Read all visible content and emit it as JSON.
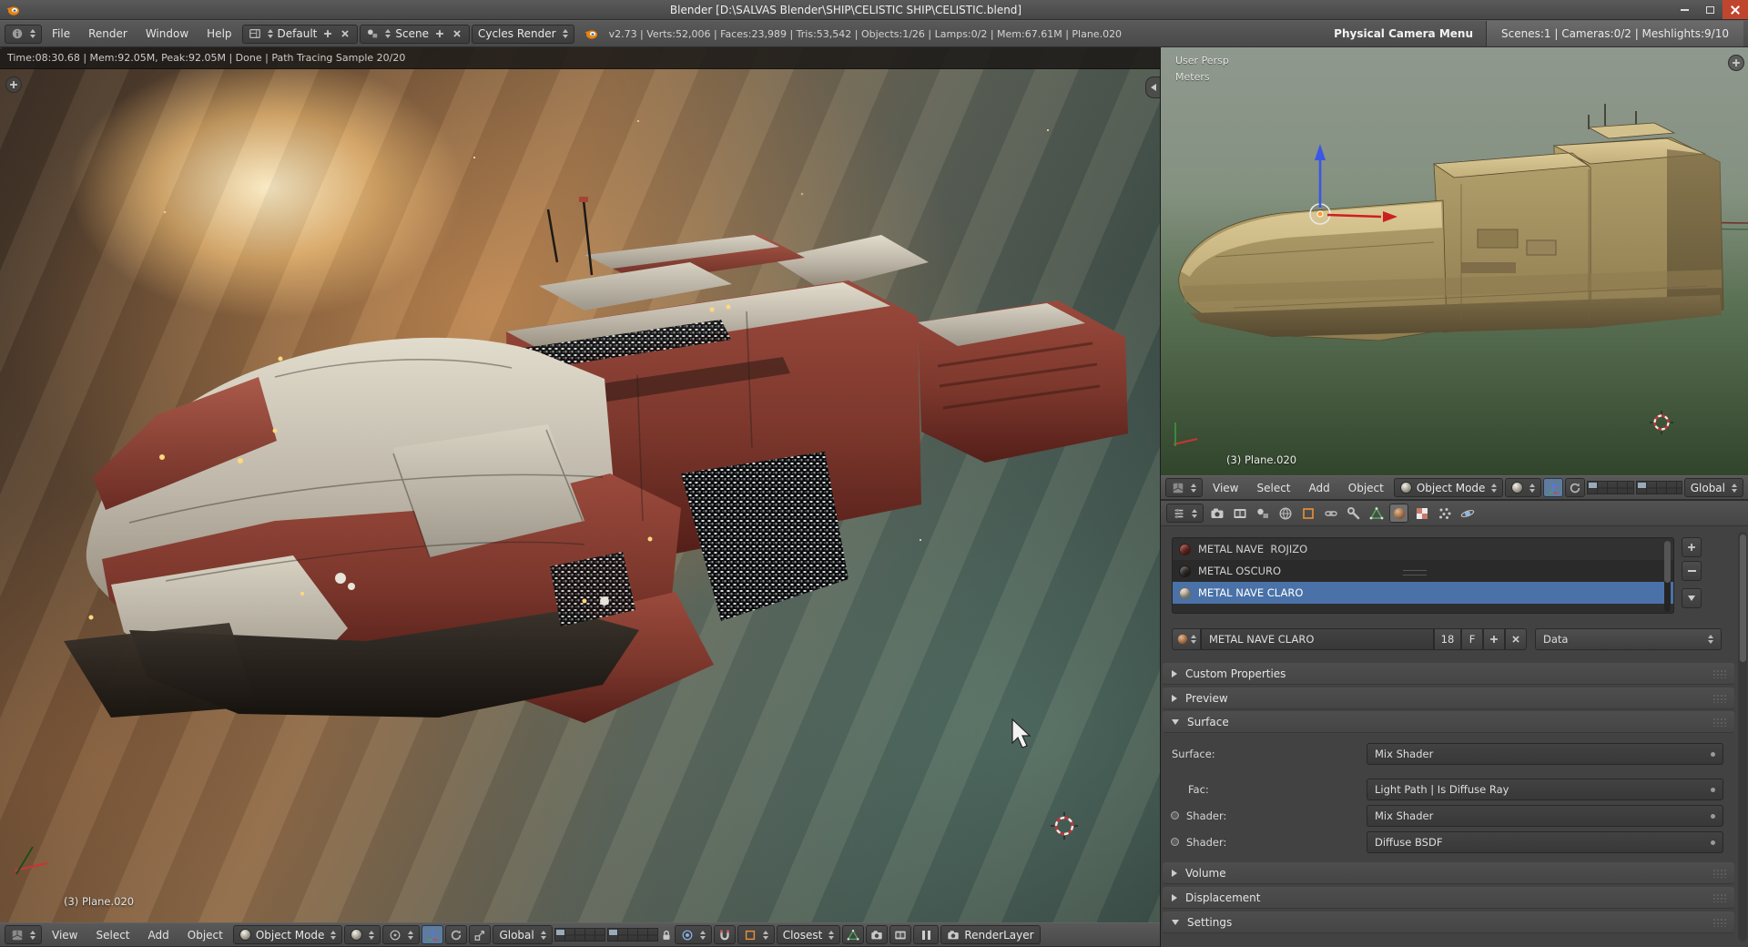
{
  "colors": {
    "accent_select_blue": "#4a72a8",
    "close_button_red": "#c0452e",
    "mat_rojizo": "#7a2d26",
    "mat_oscuro": "#36322f",
    "mat_claro": "#d9d0bf"
  },
  "titlebar": {
    "title": "Blender [D:\\SALVAS Blender\\SHIP\\CELISTIC SHIP\\CELISTIC.blend]"
  },
  "infobar": {
    "menus": [
      "File",
      "Render",
      "Window",
      "Help"
    ],
    "layout_name": "Default",
    "scene_name": "Scene",
    "engine": "Cycles Render",
    "stats": "v2.73 | Verts:52,006 | Faces:23,989 | Tris:53,542 | Objects:1/26 | Lamps:0/2 | Mem:67.61M | Plane.020",
    "camera_menu_label": "Physical Camera Menu",
    "scene_stats": "Scenes:1 | Cameras:0/2 | Meshlights:9/10"
  },
  "render_view": {
    "status_line": "Time:08:30.68 | Mem:92.05M, Peak:92.05M | Done | Path Tracing Sample 20/20",
    "object_label": "(3) Plane.020"
  },
  "view3d": {
    "persp_label": "User Persp",
    "units_label": "Meters",
    "object_label": "(3) Plane.020"
  },
  "footer": {
    "menus": [
      "View",
      "Select",
      "Add",
      "Object"
    ],
    "mode": "Object Mode",
    "orientation": "Global",
    "snap_target": "Closest",
    "render_layer": "RenderLayer"
  },
  "header3d": {
    "menus": [
      "View",
      "Select",
      "Add",
      "Object"
    ],
    "mode": "Object Mode",
    "orientation": "Global"
  },
  "materials": {
    "slots": [
      {
        "name": "METAL NAVE  ROJIZO"
      },
      {
        "name": "METAL OSCURO"
      },
      {
        "name": "METAL NAVE CLARO"
      }
    ],
    "datablock_name": "METAL NAVE CLARO",
    "users_count": "18",
    "fake_user": "F",
    "link_mode": "Data"
  },
  "panels": {
    "custom_properties": "Custom Properties",
    "preview": "Preview",
    "surface": "Surface",
    "volume": "Volume",
    "displacement": "Displacement",
    "settings": "Settings"
  },
  "surface": {
    "surface_label": "Surface:",
    "surface_value": "Mix Shader",
    "fac_label": "Fac:",
    "fac_value": "Light Path | Is Diffuse Ray",
    "shader1_label": "Shader:",
    "shader1_value": "Mix Shader",
    "shader2_label": "Shader:",
    "shader2_value": "Diffuse BSDF"
  }
}
